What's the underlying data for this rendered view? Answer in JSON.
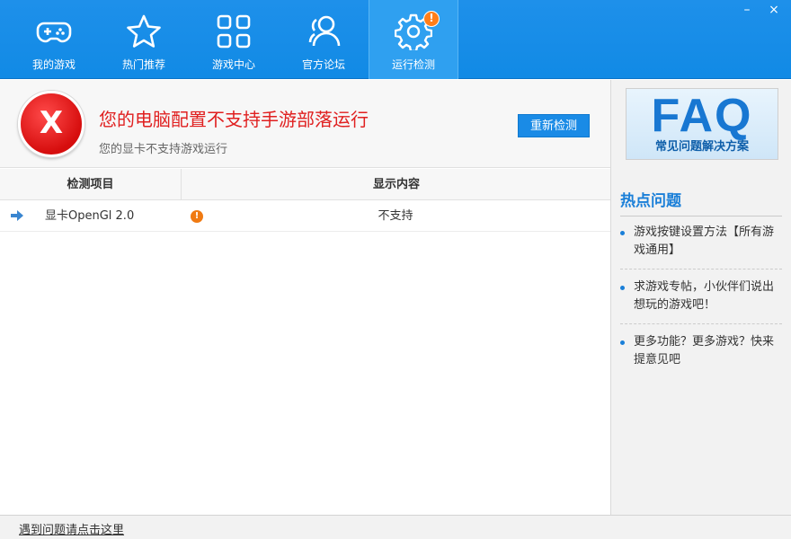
{
  "nav": {
    "items": [
      {
        "label": "我的游戏",
        "icon": "gamepad-icon"
      },
      {
        "label": "热门推荐",
        "icon": "star-icon"
      },
      {
        "label": "游戏中心",
        "icon": "grid-icon"
      },
      {
        "label": "官方论坛",
        "icon": "users-icon"
      },
      {
        "label": "运行检测",
        "icon": "gear-icon"
      }
    ],
    "active_index": 4,
    "badge": "!"
  },
  "window": {
    "minimize": "–",
    "close": "×"
  },
  "result": {
    "headline": "您的电脑配置不支持手游部落运行",
    "subline": "您的显卡不支持游戏运行",
    "error_mark": "X",
    "recheck_button": "重新检测"
  },
  "table": {
    "columns": [
      "检测项目",
      "显示内容"
    ],
    "rows": [
      {
        "item": "显卡OpenGl 2.0",
        "status": "不支持",
        "warning": "!"
      }
    ]
  },
  "sidebar": {
    "faq_big": "FAQ",
    "faq_small": "常见问题解决方案",
    "hot_title": "热点问题",
    "hot_items": [
      "游戏按键设置方法【所有游戏通用】",
      "求游戏专帖，小伙伴们说出想玩的游戏吧！",
      "更多功能？更多游戏？快来提意见吧"
    ]
  },
  "footer": {
    "link": "遇到问题请点击这里"
  },
  "colors": {
    "accent": "#1a8be6",
    "error": "#e02020",
    "warning": "#f07a12"
  }
}
